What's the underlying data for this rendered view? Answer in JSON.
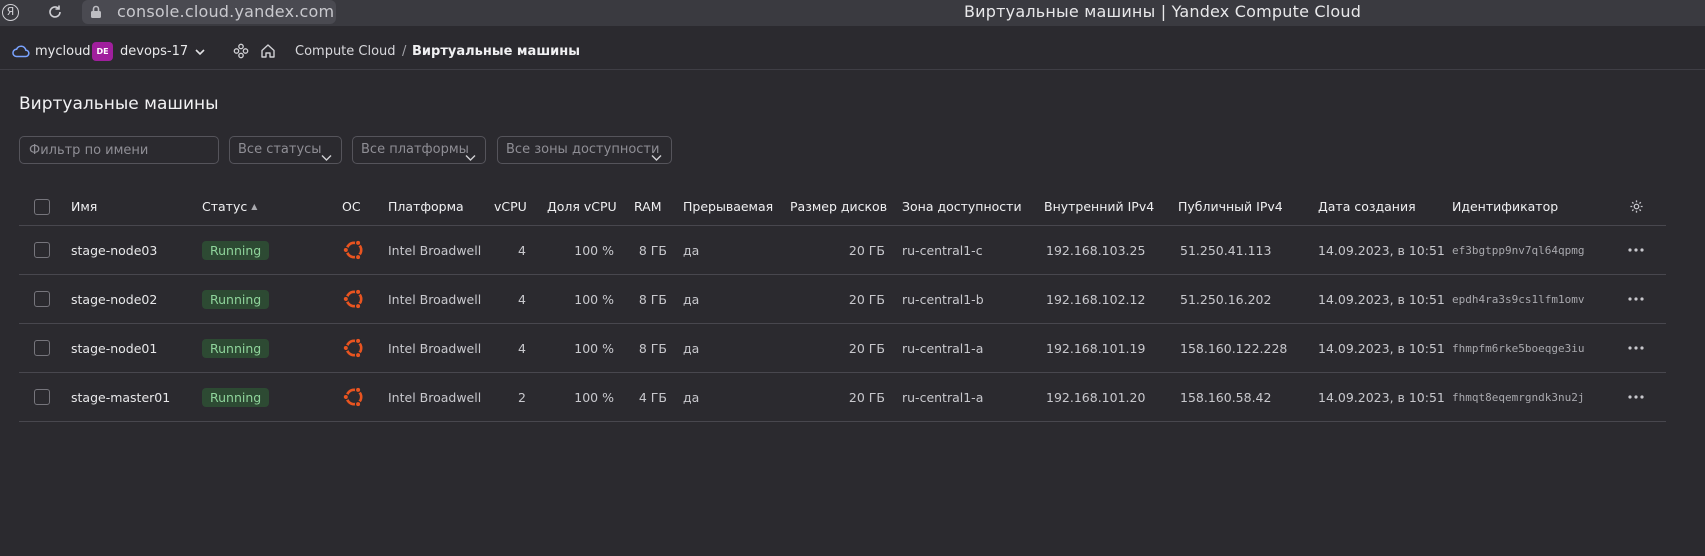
{
  "browser": {
    "logo": "Я",
    "url": "console.cloud.yandex.com",
    "title": "Виртуальные машины | Yandex Compute Cloud"
  },
  "header": {
    "cloud_name": "mycloud",
    "folder_badge": "DE",
    "folder_name": "devops-17",
    "breadcrumb": [
      "Compute Cloud",
      "Виртуальные машины"
    ],
    "separator": "/"
  },
  "page": {
    "title": "Виртуальные машины",
    "filters": {
      "name_placeholder": "Фильтр по имени",
      "status": "Все статусы",
      "platform": "Все платформы",
      "zone": "Все зоны доступности"
    }
  },
  "table": {
    "columns": [
      "Имя",
      "Статус",
      "ОС",
      "Платформа",
      "vCPU",
      "Доля vCPU",
      "RAM",
      "Прерываемая",
      "Размер дисков",
      "Зона доступности",
      "Внутренний IPv4",
      "Публичный IPv4",
      "Дата создания",
      "Идентификатор"
    ],
    "rows": [
      {
        "name": "stage-node03",
        "status": "Running",
        "os": "ubuntu-icon",
        "platform": "Intel Broadwell",
        "vcpu": "4",
        "vcpu_share": "100 %",
        "ram": "8 ГБ",
        "preemptible": "да",
        "disk": "20 ГБ",
        "zone": "ru-central1-c",
        "internal_ip": "192.168.103.25",
        "public_ip": "51.250.41.113",
        "created": "14.09.2023, в 10:51",
        "id": "ef3bgtpp9nv7ql64qpmg"
      },
      {
        "name": "stage-node02",
        "status": "Running",
        "os": "ubuntu-icon",
        "platform": "Intel Broadwell",
        "vcpu": "4",
        "vcpu_share": "100 %",
        "ram": "8 ГБ",
        "preemptible": "да",
        "disk": "20 ГБ",
        "zone": "ru-central1-b",
        "internal_ip": "192.168.102.12",
        "public_ip": "51.250.16.202",
        "created": "14.09.2023, в 10:51",
        "id": "epdh4ra3s9cs1lfm1omv"
      },
      {
        "name": "stage-node01",
        "status": "Running",
        "os": "ubuntu-icon",
        "platform": "Intel Broadwell",
        "vcpu": "4",
        "vcpu_share": "100 %",
        "ram": "8 ГБ",
        "preemptible": "да",
        "disk": "20 ГБ",
        "zone": "ru-central1-a",
        "internal_ip": "192.168.101.19",
        "public_ip": "158.160.122.228",
        "created": "14.09.2023, в 10:51",
        "id": "fhmpfm6rke5boeqge3iu"
      },
      {
        "name": "stage-master01",
        "status": "Running",
        "os": "ubuntu-icon",
        "platform": "Intel Broadwell",
        "vcpu": "2",
        "vcpu_share": "100 %",
        "ram": "4 ГБ",
        "preemptible": "да",
        "disk": "20 ГБ",
        "zone": "ru-central1-a",
        "internal_ip": "192.168.101.20",
        "public_ip": "158.160.58.42",
        "created": "14.09.2023, в 10:51",
        "id": "fhmqt8eqemrgndk3nu2j"
      }
    ]
  },
  "colors": {
    "background": "#2b2a2f",
    "running_badge_bg": "#2d4a33",
    "running_badge_text": "#8fd49b",
    "ubuntu_orange": "#e95420",
    "folder_badge": "#a01f9d"
  }
}
